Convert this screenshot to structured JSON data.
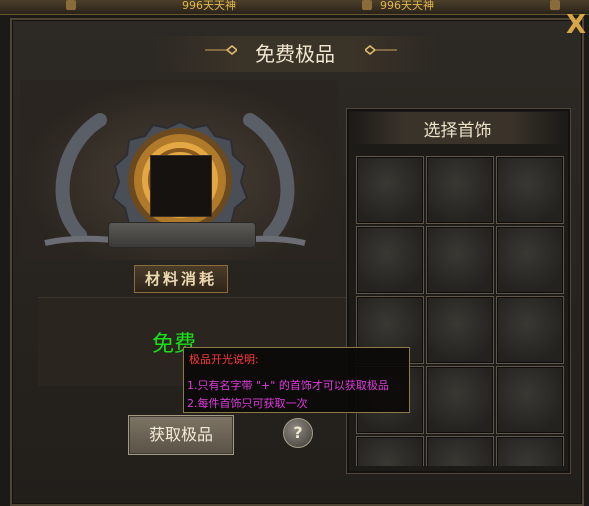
{
  "top_bar": {
    "names": [
      "996天天神",
      "996天天神"
    ]
  },
  "window": {
    "title": "免费极品",
    "close_label": "X"
  },
  "left": {
    "material_label": "材料消耗",
    "cost_text": "免费",
    "get_button_label": "获取极品",
    "help_label": "?"
  },
  "right": {
    "title": "选择首饰",
    "slots": 15
  },
  "tooltip": {
    "title": "极品开光说明:",
    "line1": "1.只有名字带 \"+\" 的首饰才可以获取极品",
    "line2": "2.每件首饰只可获取一次"
  },
  "colors": {
    "free": "#19e019",
    "tip_title": "#ff3b3b",
    "tip_text": "#e039e0",
    "gold": "#d9a645"
  },
  "icons": [
    "close-icon",
    "question-icon",
    "title-ornament-icon"
  ]
}
